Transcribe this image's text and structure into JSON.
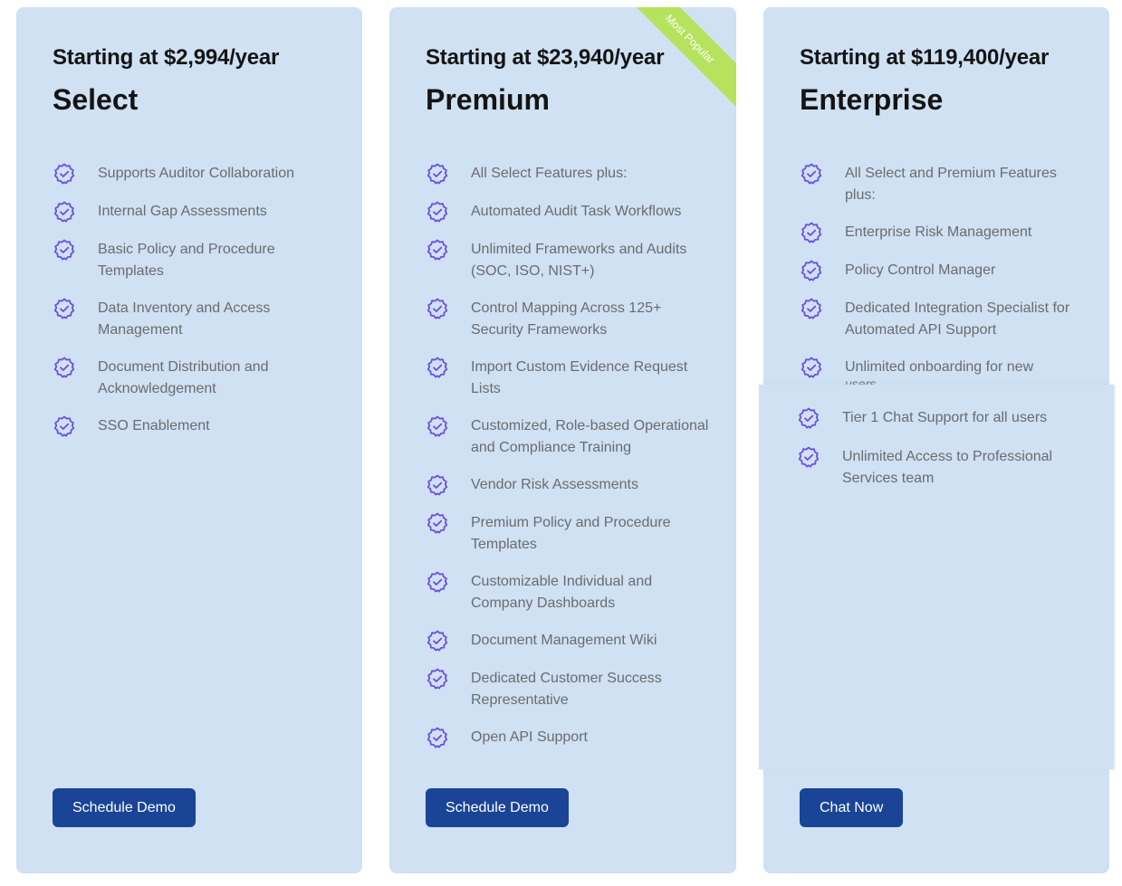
{
  "colors": {
    "card_bg": "#cfe1f3",
    "button_bg": "#1a4496",
    "ribbon_bg": "#b5e35e",
    "icon": "#6a4ee0"
  },
  "plans": [
    {
      "price": "Starting at $2,994/year",
      "name": "Select",
      "features": [
        "Supports Auditor Collaboration",
        "Internal Gap Assessments",
        "Basic Policy and Procedure Templates",
        "Data Inventory and Access Management",
        "Document Distribution and Acknowledgement",
        "SSO Enablement"
      ],
      "cta": "Schedule Demo"
    },
    {
      "price": "Starting at $23,940/year",
      "name": "Premium",
      "badge": "Most Popular",
      "features": [
        "All Select Features plus:",
        "Automated Audit Task Workflows",
        "Unlimited Frameworks and Audits (SOC, ISO, NIST+)",
        "Control Mapping Across 125+ Security Frameworks",
        "Import Custom Evidence Request Lists",
        "Customized, Role-based Operational and Compliance Training",
        "Vendor Risk Assessments",
        "Premium Policy and Procedure Templates",
        "Customizable Individual and Company Dashboards",
        "Document Management Wiki",
        "Dedicated Customer Success Representative",
        "Open API Support"
      ],
      "cta": "Schedule Demo"
    },
    {
      "price": "Starting at $119,400/year",
      "name": "Enterprise",
      "features": [
        "All Select and Premium Features plus:",
        "Enterprise Risk Management",
        "Policy Control Manager",
        "Dedicated Integration Specialist for Automated API Support",
        "Unlimited onboarding for new"
      ],
      "features_fragment": "users",
      "features_overlay": [
        "Tier 1 Chat Support for all users",
        "Unlimited Access to Professional Services team"
      ],
      "cta": "Chat Now"
    }
  ]
}
